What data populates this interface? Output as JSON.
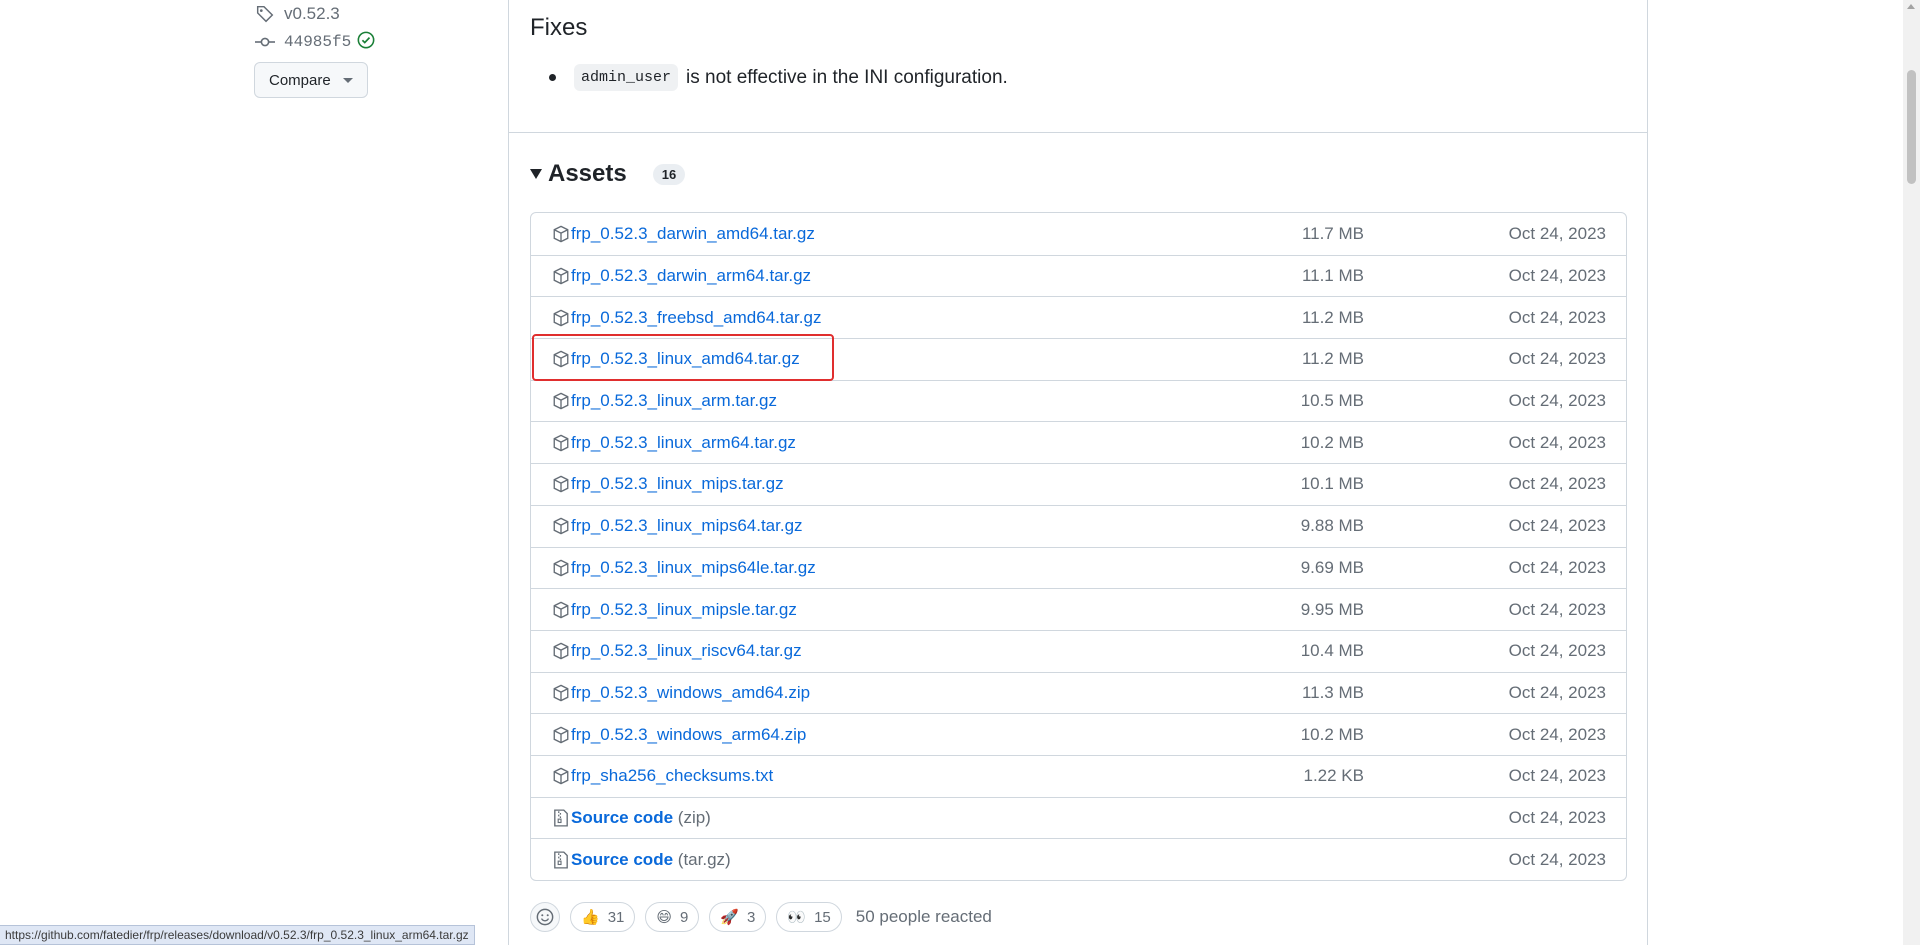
{
  "sidebar": {
    "tag": "v0.52.3",
    "commit": "44985f5",
    "compare_label": "Compare"
  },
  "fixes": {
    "title": "Fixes",
    "code": "admin_user",
    "text": "is not effective in the INI configuration."
  },
  "assets": {
    "title": "Assets",
    "count": "16",
    "rows": [
      {
        "name": "frp_0.52.3_darwin_amd64.tar.gz",
        "suffix": "",
        "size": "11.7 MB",
        "date": "Oct 24, 2023",
        "icon": "package-icon"
      },
      {
        "name": "frp_0.52.3_darwin_arm64.tar.gz",
        "suffix": "",
        "size": "11.1 MB",
        "date": "Oct 24, 2023",
        "icon": "package-icon"
      },
      {
        "name": "frp_0.52.3_freebsd_amd64.tar.gz",
        "suffix": "",
        "size": "11.2 MB",
        "date": "Oct 24, 2023",
        "icon": "package-icon"
      },
      {
        "name": "frp_0.52.3_linux_amd64.tar.gz",
        "suffix": "",
        "size": "11.2 MB",
        "date": "Oct 24, 2023",
        "icon": "package-icon"
      },
      {
        "name": "frp_0.52.3_linux_arm.tar.gz",
        "suffix": "",
        "size": "10.5 MB",
        "date": "Oct 24, 2023",
        "icon": "package-icon"
      },
      {
        "name": "frp_0.52.3_linux_arm64.tar.gz",
        "suffix": "",
        "size": "10.2 MB",
        "date": "Oct 24, 2023",
        "icon": "package-icon"
      },
      {
        "name": "frp_0.52.3_linux_mips.tar.gz",
        "suffix": "",
        "size": "10.1 MB",
        "date": "Oct 24, 2023",
        "icon": "package-icon"
      },
      {
        "name": "frp_0.52.3_linux_mips64.tar.gz",
        "suffix": "",
        "size": "9.88 MB",
        "date": "Oct 24, 2023",
        "icon": "package-icon"
      },
      {
        "name": "frp_0.52.3_linux_mips64le.tar.gz",
        "suffix": "",
        "size": "9.69 MB",
        "date": "Oct 24, 2023",
        "icon": "package-icon"
      },
      {
        "name": "frp_0.52.3_linux_mipsle.tar.gz",
        "suffix": "",
        "size": "9.95 MB",
        "date": "Oct 24, 2023",
        "icon": "package-icon"
      },
      {
        "name": "frp_0.52.3_linux_riscv64.tar.gz",
        "suffix": "",
        "size": "10.4 MB",
        "date": "Oct 24, 2023",
        "icon": "package-icon"
      },
      {
        "name": "frp_0.52.3_windows_amd64.zip",
        "suffix": "",
        "size": "11.3 MB",
        "date": "Oct 24, 2023",
        "icon": "package-icon"
      },
      {
        "name": "frp_0.52.3_windows_arm64.zip",
        "suffix": "",
        "size": "10.2 MB",
        "date": "Oct 24, 2023",
        "icon": "package-icon"
      },
      {
        "name": "frp_sha256_checksums.txt",
        "suffix": "",
        "size": "1.22 KB",
        "date": "Oct 24, 2023",
        "icon": "package-icon"
      },
      {
        "name": "Source code",
        "suffix": "(zip)",
        "size": "",
        "date": "Oct 24, 2023",
        "icon": "file-zip-icon"
      },
      {
        "name": "Source code",
        "suffix": "(tar.gz)",
        "size": "",
        "date": "Oct 24, 2023",
        "icon": "file-zip-icon"
      }
    ]
  },
  "reactions": {
    "items": [
      {
        "emoji": "👍",
        "count": "31"
      },
      {
        "emoji": "😄",
        "count": "9"
      },
      {
        "emoji": "🚀",
        "count": "3"
      },
      {
        "emoji": "👀",
        "count": "15"
      }
    ],
    "total": "50 people reacted"
  },
  "status_url": "https://github.com/fatedier/frp/releases/download/v0.52.3/frp_0.52.3_linux_arm64.tar.gz",
  "colors": {
    "link": "#0969da",
    "muted": "#656d76",
    "border": "#d0d7de",
    "highlight": "#e02e2e",
    "success": "#1a7f37"
  }
}
